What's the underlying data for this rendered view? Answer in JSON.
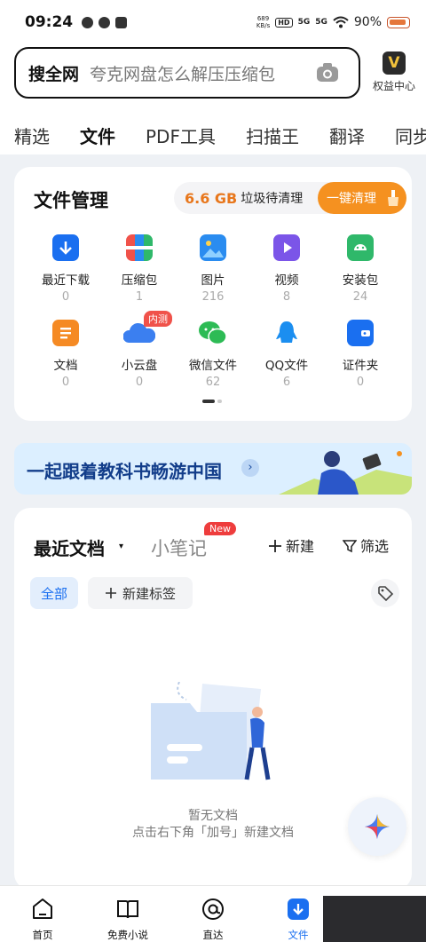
{
  "status_bar": {
    "time": "09:24",
    "net_speed_top": "689",
    "net_speed_unit": "KB/s",
    "hd": "HD",
    "sig1": "5G",
    "sig2": "5G",
    "battery": "90%"
  },
  "search": {
    "brand": "搜全网",
    "placeholder": "夸克网盘怎么解压压缩包"
  },
  "vip": {
    "logo": "V",
    "label": "权益中心"
  },
  "tabs": [
    {
      "label": "精选"
    },
    {
      "label": "文件"
    },
    {
      "label": "PDF工具"
    },
    {
      "label": "扫描王"
    },
    {
      "label": "翻译"
    },
    {
      "label": "同步学"
    }
  ],
  "file_manager": {
    "title": "文件管理",
    "clean_size": "6.6 GB",
    "clean_text": "垃圾待清理",
    "clean_button": "一键清理",
    "items": [
      {
        "label": "最近下载",
        "count": "0",
        "icon": "download-icon",
        "color": "#1a6ff0"
      },
      {
        "label": "压缩包",
        "count": "1",
        "icon": "archive-icon",
        "color": "#f0524a"
      },
      {
        "label": "图片",
        "count": "216",
        "icon": "image-icon",
        "color": "#2a8cf0"
      },
      {
        "label": "视频",
        "count": "8",
        "icon": "video-icon",
        "color": "#7b55e8"
      },
      {
        "label": "安装包",
        "count": "24",
        "icon": "android-icon",
        "color": "#2fb86a"
      },
      {
        "label": "文档",
        "count": "0",
        "icon": "document-icon",
        "color": "#f58a24"
      },
      {
        "label": "小云盘",
        "count": "0",
        "icon": "cloud-icon",
        "color": "#3b7ff0",
        "badge": "内测"
      },
      {
        "label": "微信文件",
        "count": "62",
        "icon": "wechat-icon",
        "color": "#2dbb55"
      },
      {
        "label": "QQ文件",
        "count": "6",
        "icon": "qq-icon",
        "color": "#1b8ef0"
      },
      {
        "label": "证件夹",
        "count": "0",
        "icon": "wallet-icon",
        "color": "#1a6ff0"
      }
    ]
  },
  "banner": {
    "text": "一起跟着教科书畅游中国",
    "arrow": "›"
  },
  "recent_docs": {
    "title": "最近文档",
    "caret": "▾",
    "notes_tab": "小笔记",
    "notes_badge": "New",
    "new_label": "新建",
    "filter_label": "筛选",
    "chip_all": "全部",
    "chip_add": "新建标签",
    "empty_title": "暂无文档",
    "empty_hint": "点击右下角「加号」新建文档"
  },
  "bottom_nav": [
    {
      "label": "首页"
    },
    {
      "label": "免费小说"
    },
    {
      "label": "直达"
    },
    {
      "label": "文件"
    }
  ],
  "colors": {
    "accent": "#1a6ff0",
    "orange": "#f59120",
    "banner_bg": "#dcefff"
  }
}
